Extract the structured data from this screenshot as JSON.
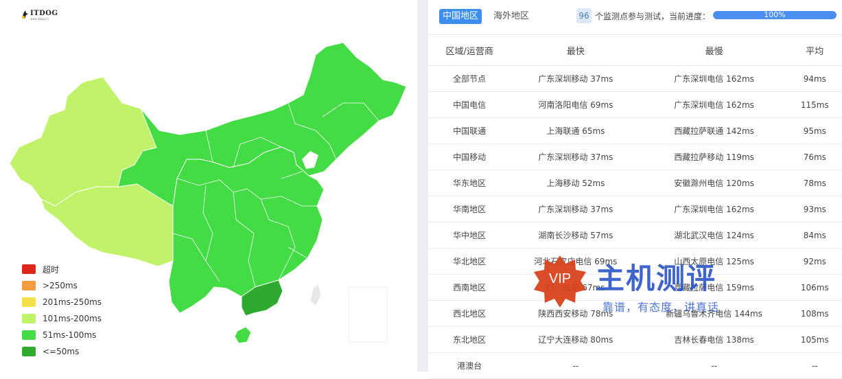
{
  "brand": {
    "logo_text": "ITDOG",
    "logo_sub": "www.itdog.cn"
  },
  "colors": {
    "timeout": "#e0251c",
    "over250": "#f29b40",
    "ms201_250": "#f4e04a",
    "ms101_200": "#c0f36a",
    "ms51_100": "#44dc44",
    "ms_le50": "#2eaa2e",
    "accent": "#3c8ef0"
  },
  "legend": [
    {
      "label": "超时",
      "color": "#e0251c"
    },
    {
      "label": ">250ms",
      "color": "#f29b40"
    },
    {
      "label": "201ms-250ms",
      "color": "#f4e04a"
    },
    {
      "label": "101ms-200ms",
      "color": "#c0f36a"
    },
    {
      "label": "51ms-100ms",
      "color": "#44dc44"
    },
    {
      "label": "<=50ms",
      "color": "#2eaa2e"
    }
  ],
  "tabs": {
    "domestic": "中国地区",
    "overseas": "海外地区"
  },
  "progress": {
    "count": "96",
    "status_text": "个监测点参与测试，当前进度：",
    "percent_label": "100%",
    "percent": 100
  },
  "table": {
    "headers": [
      "区域/运营商",
      "最快",
      "最慢",
      "平均"
    ],
    "rows": [
      [
        "全部节点",
        "广东深圳移动 37ms",
        "广东深圳电信 162ms",
        "94ms"
      ],
      [
        "中国电信",
        "河南洛阳电信 69ms",
        "广东深圳电信 162ms",
        "115ms"
      ],
      [
        "中国联通",
        "上海联通 65ms",
        "西藏拉萨联通 142ms",
        "95ms"
      ],
      [
        "中国移动",
        "广东深圳移动 37ms",
        "西藏拉萨移动 119ms",
        "76ms"
      ],
      [
        "华东地区",
        "上海移动 52ms",
        "安徽滁州电信 120ms",
        "78ms"
      ],
      [
        "华南地区",
        "广东深圳移动 37ms",
        "广东深圳电信 162ms",
        "93ms"
      ],
      [
        "华中地区",
        "湖南长沙移动 57ms",
        "湖北武汉电信 124ms",
        "84ms"
      ],
      [
        "华北地区",
        "河北石家庄电信 69ms",
        "山西太原电信 125ms",
        "92ms"
      ],
      [
        "西南地区",
        "四川成都 67ms",
        "西藏拉萨电信 159ms",
        "106ms"
      ],
      [
        "西北地区",
        "陕西西安移动 78ms",
        "新疆乌鲁木齐电信 144ms",
        "108ms"
      ],
      [
        "东北地区",
        "辽宁大连移动 80ms",
        "吉林长春电信 138ms",
        "105ms"
      ],
      [
        "港澳台",
        "--",
        "--",
        "--"
      ]
    ]
  },
  "watermark": {
    "badge": "VIP",
    "title": "主机测评",
    "slogan": "靠谱，有态度，讲真话"
  }
}
